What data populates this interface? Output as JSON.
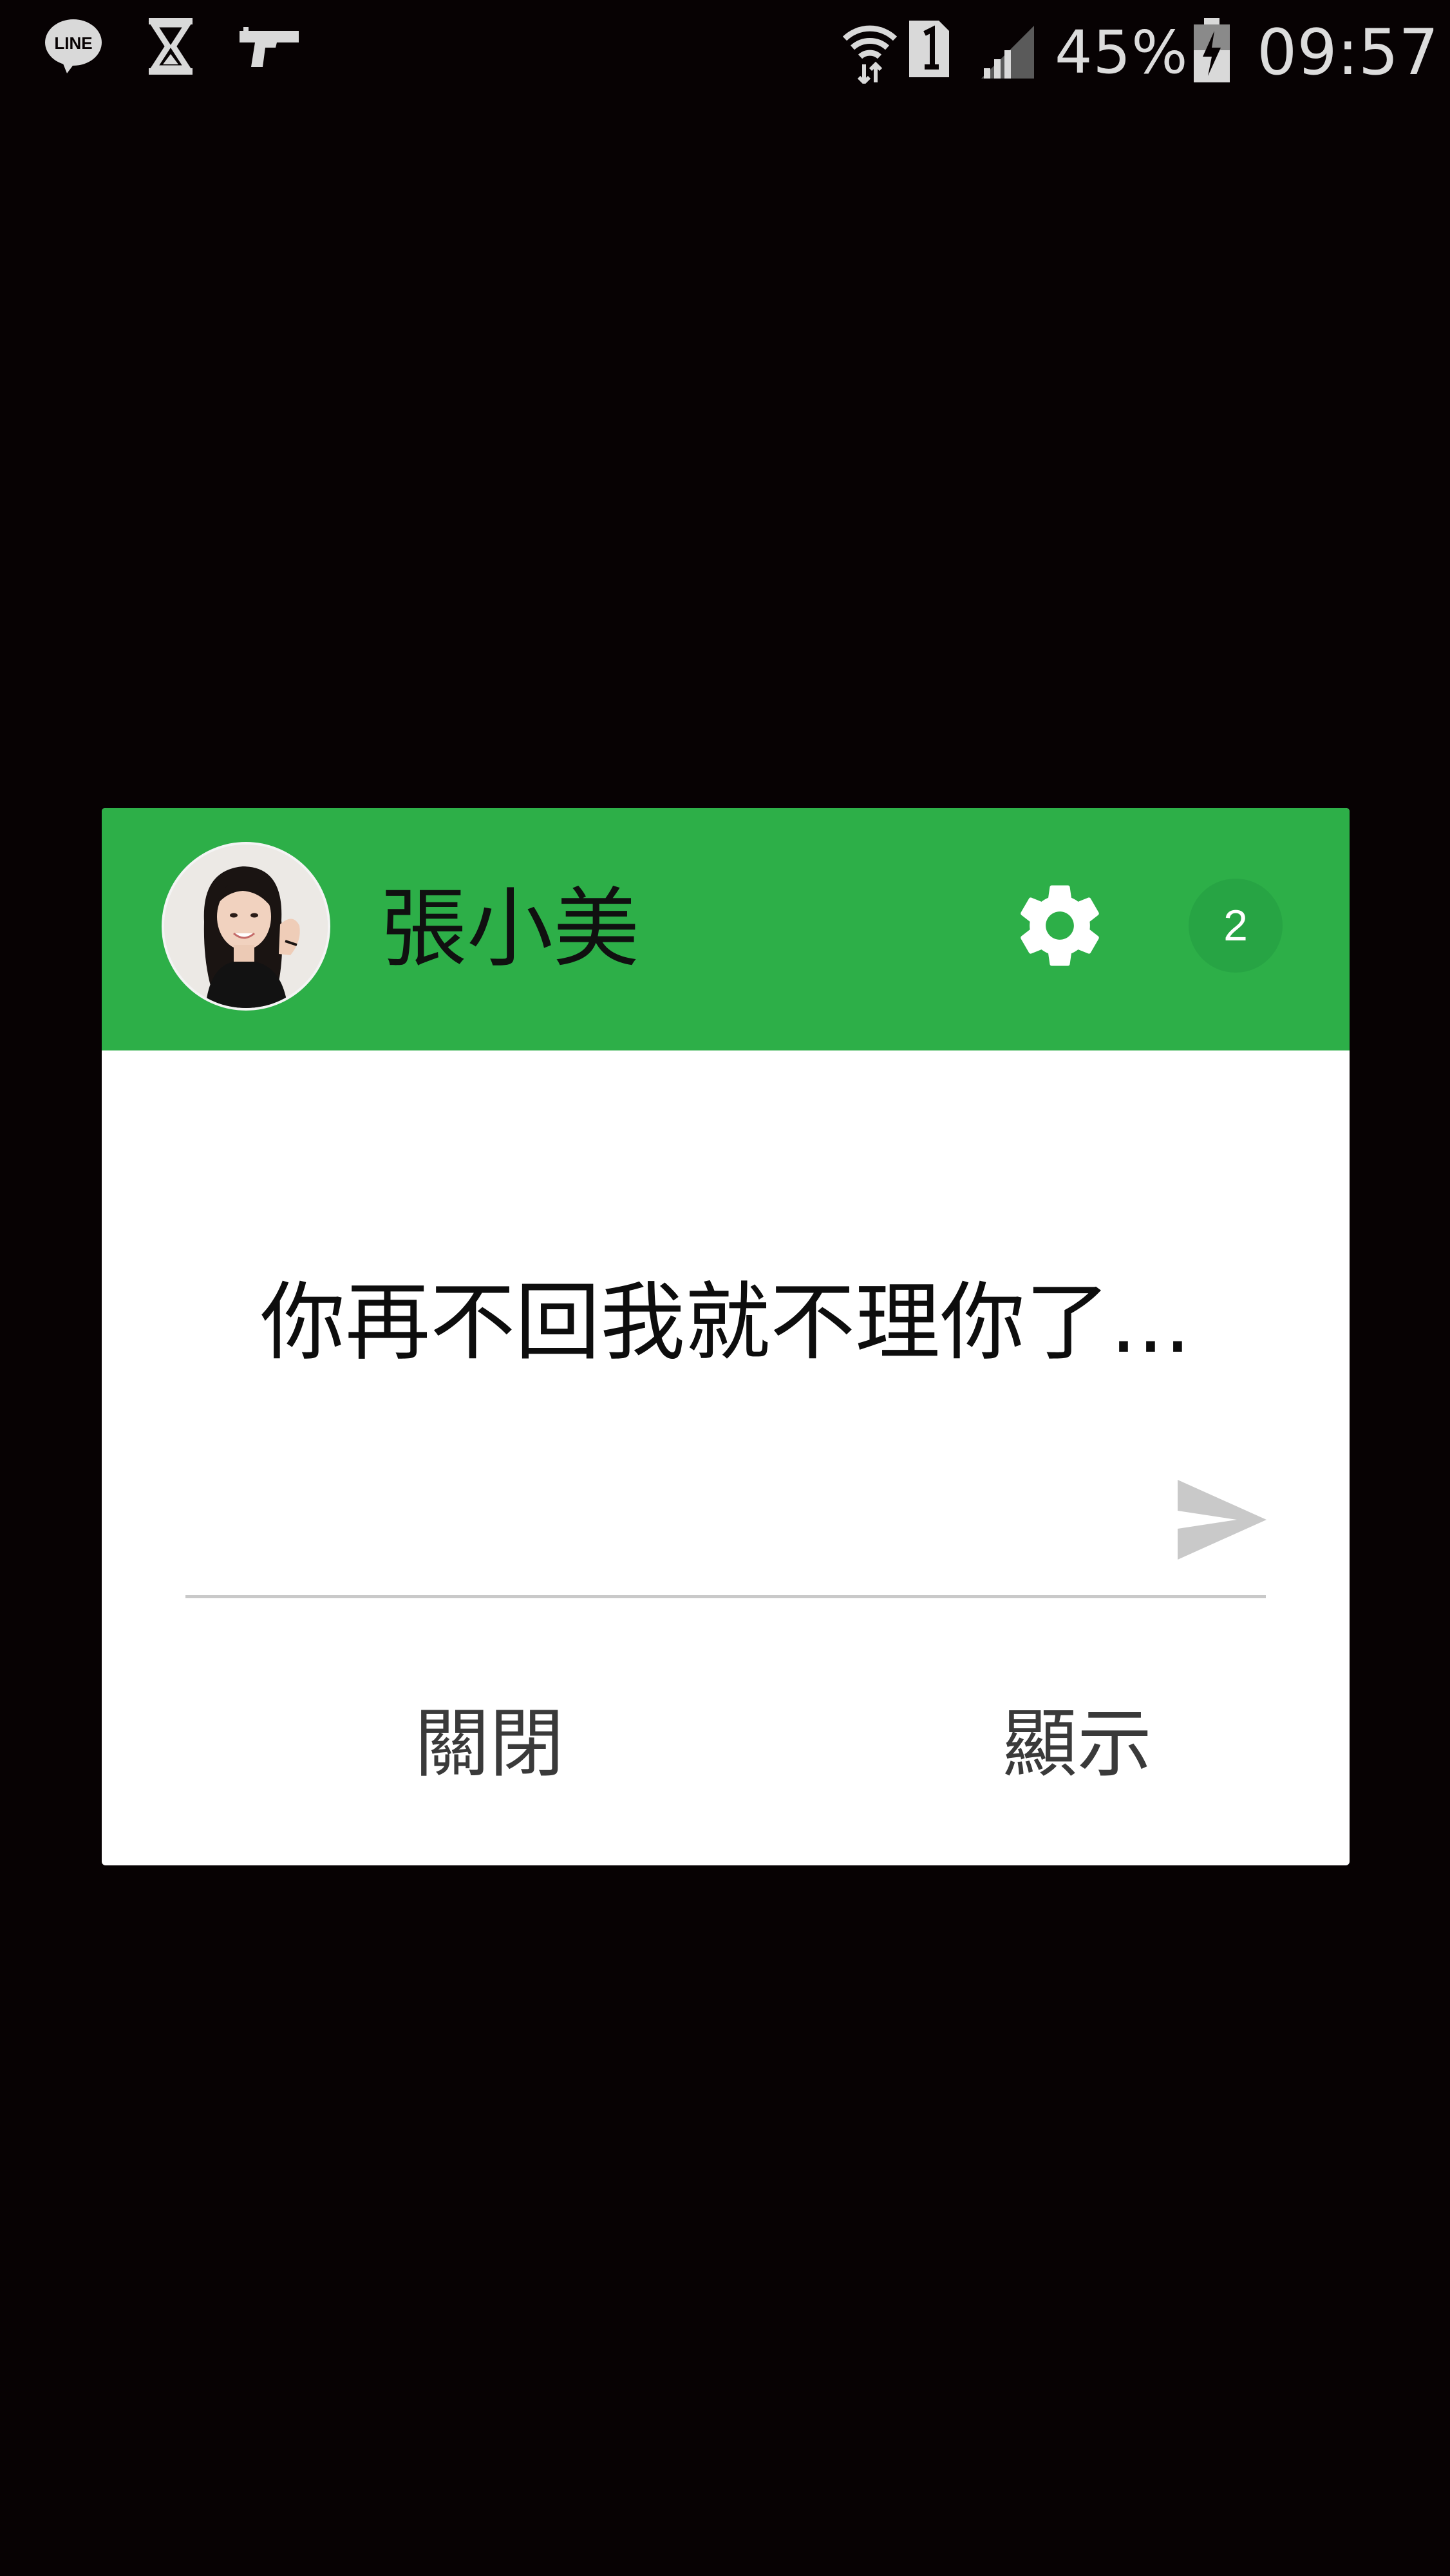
{
  "status_bar": {
    "left_icons": [
      "line-app-icon",
      "hourglass-icon",
      "gun-icon"
    ],
    "right_icons": [
      "wifi-icon",
      "sim-1-icon",
      "signal-icon",
      "battery-charging-icon"
    ],
    "battery_percent": "45%",
    "time": "09:57"
  },
  "dialog": {
    "sender_name": "張小美",
    "unread_count": "2",
    "message": "你再不回我就不理你了...",
    "reply_placeholder": "",
    "close_label": "關閉",
    "show_label": "顯示"
  },
  "colors": {
    "header_green": "#2daf48",
    "badge_green": "#27a444",
    "background": "#070203"
  }
}
